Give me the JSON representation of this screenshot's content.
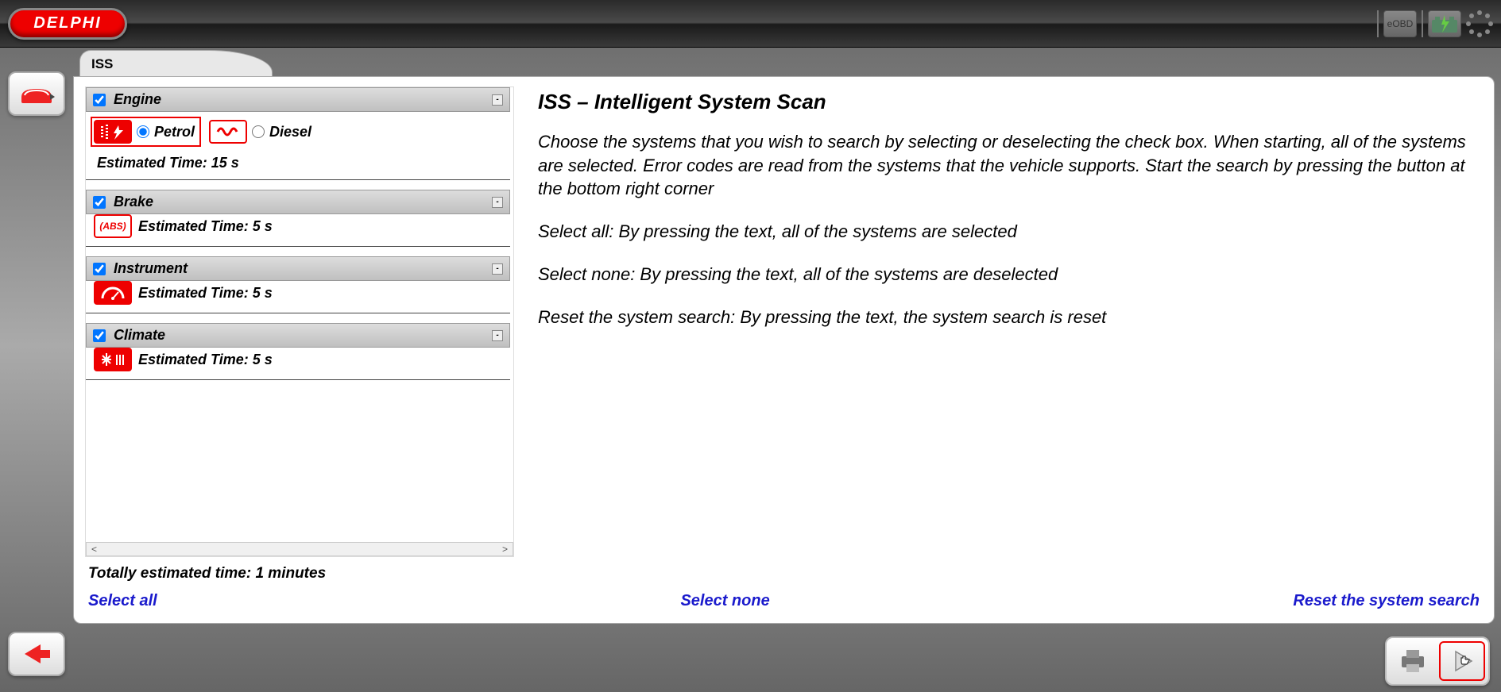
{
  "brand": "DELPHI",
  "top_right": {
    "eobd_label": "eOBD"
  },
  "tab_title": "ISS",
  "systems": [
    {
      "key": "engine",
      "label": "Engine",
      "checked": true,
      "options": [
        {
          "key": "petrol",
          "label": "Petrol",
          "selected": true,
          "icon": "spark-icon",
          "highlighted": true
        },
        {
          "key": "diesel",
          "label": "Diesel",
          "selected": false,
          "icon": "glowplug-icon",
          "highlighted": false
        }
      ],
      "estimated_label": "Estimated Time: 15 s"
    },
    {
      "key": "brake",
      "label": "Brake",
      "checked": true,
      "icon": "abs-icon",
      "estimated_label": "Estimated Time: 5 s"
    },
    {
      "key": "instrument",
      "label": "Instrument",
      "checked": true,
      "icon": "gauge-icon",
      "estimated_label": "Estimated Time: 5 s"
    },
    {
      "key": "climate",
      "label": "Climate",
      "checked": true,
      "icon": "climate-icon",
      "estimated_label": "Estimated Time: 5 s"
    }
  ],
  "total_estimated": "Totally estimated time: 1 minutes",
  "actions": {
    "select_all": "Select all",
    "select_none": "Select none",
    "reset": "Reset the system search"
  },
  "info": {
    "title": "ISS – Intelligent System Scan",
    "p1": "Choose the systems that you wish to search by selecting or deselecting the check box. When starting, all of the systems are selected. Error codes are read from the systems that the vehicle supports. Start the search by pressing the button at the bottom right corner",
    "p2": "Select all: By pressing the text, all of the systems are selected",
    "p3": "Select none: By pressing the text, all of the systems are deselected",
    "p4": "Reset the system search: By pressing the text, the system search is reset"
  }
}
